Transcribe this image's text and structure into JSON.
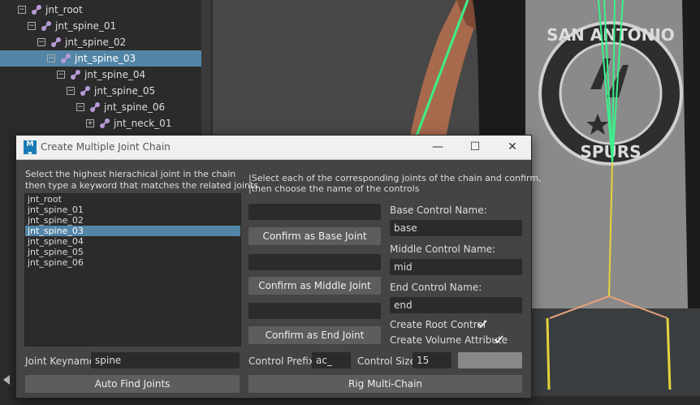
{
  "outliner": {
    "items": [
      {
        "label": "jnt_root",
        "depth": 0,
        "expander": "minus"
      },
      {
        "label": "jnt_spine_01",
        "depth": 1,
        "expander": "minus"
      },
      {
        "label": "jnt_spine_02",
        "depth": 2,
        "expander": "minus"
      },
      {
        "label": "jnt_spine_03",
        "depth": 3,
        "expander": "minus",
        "selected": true
      },
      {
        "label": "jnt_spine_04",
        "depth": 4,
        "expander": "minus"
      },
      {
        "label": "jnt_spine_05",
        "depth": 5,
        "expander": "minus"
      },
      {
        "label": "jnt_spine_06",
        "depth": 6,
        "expander": "minus"
      },
      {
        "label": "jnt_neck_01",
        "depth": 7,
        "expander": "plus"
      }
    ]
  },
  "viewport": {
    "shirt_logo_text_top": "SAN ANTONIO",
    "shirt_logo_text_bottom": "SPURS"
  },
  "dialog": {
    "app_icon": "maya-icon",
    "title": "Create Multiple Joint Chain",
    "minimize": "—",
    "maximize": "☐",
    "close": "✕",
    "left_instructions_1": "Select the highest hierachical joint in the chain",
    "left_instructions_2": "then type a keyword that matches the related joints",
    "right_instructions_1": "|Select each of the corresponding joints of the chain and confirm,",
    "right_instructions_2": "|then choose the name of the controls",
    "joint_list": [
      "jnt_root",
      "jnt_spine_01",
      "jnt_spine_02",
      "jnt_spine_03",
      "jnt_spine_04",
      "jnt_spine_05",
      "jnt_spine_06"
    ],
    "joint_list_selected": "jnt_spine_03",
    "joint_keyname_label": "Joint Keyname:",
    "joint_keyname_value": "spine",
    "auto_find_button": "Auto Find Joints",
    "base_joint_value": "",
    "confirm_base_button": "Confirm as Base Joint",
    "middle_joint_value": "",
    "confirm_middle_button": "Confirm as Middle Joint",
    "end_joint_value": "",
    "confirm_end_button": "Confirm as End Joint",
    "base_control_label": "Base Control Name:",
    "base_control_value": "base",
    "middle_control_label": "Middle Control Name:",
    "middle_control_value": "mid",
    "end_control_label": "End Control Name:",
    "end_control_value": "end",
    "create_root_label": "Create Root Control",
    "create_root_checked": true,
    "create_volume_label": "Create Volume Attribute",
    "create_volume_checked": true,
    "control_prefix_label": "Control Prefix:",
    "control_prefix_value": "ac_",
    "control_size_label": "Control Size",
    "control_size_value": "15",
    "rig_button": "Rig Multi-Chain"
  },
  "colors": {
    "selection": "#5285a6",
    "panel_bg": "#444444",
    "field_bg": "#2b2b2b",
    "button_bg": "#5d5d5d",
    "joint_green": "#3cf08a",
    "joint_yellow": "#e6d23c"
  }
}
